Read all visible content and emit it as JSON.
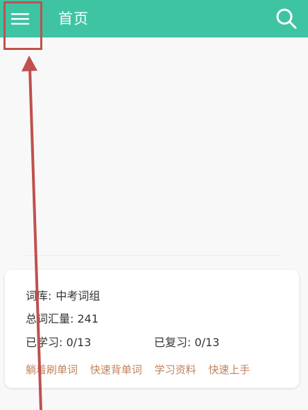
{
  "header": {
    "title": "首页",
    "menu_icon": "hamburger-menu-icon",
    "search_icon": "search-icon",
    "accent_color": "#3ec4a3"
  },
  "card": {
    "library_label": "词库:",
    "library_value": "中考词组",
    "vocab_label": "总词汇量:",
    "vocab_value": "241",
    "learned_label": "已学习:",
    "learned_value": "0/13",
    "reviewed_label": "已复习:",
    "reviewed_value": "0/13",
    "link_color": "#c0825a",
    "links": [
      "躺着刷单词",
      "快速背单词",
      "学习资料",
      "快速上手"
    ]
  },
  "annotation": {
    "color": "#c0504d"
  }
}
